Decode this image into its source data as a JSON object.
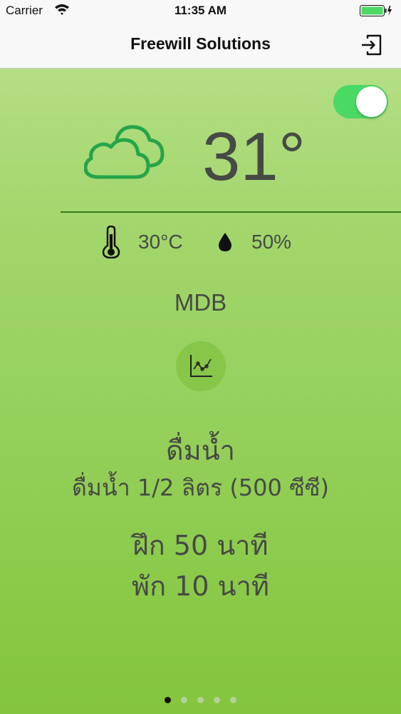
{
  "status_bar": {
    "carrier": "Carrier",
    "time": "11:35 AM"
  },
  "nav": {
    "title": "Freewill Solutions",
    "logout_icon": "logout-icon"
  },
  "toggle": {
    "on": true,
    "color": "#4bd965"
  },
  "weather": {
    "icon": "cloud-icon",
    "temperature": "31°",
    "temp_c": "30°C",
    "humidity": "50%"
  },
  "location": "MDB",
  "chart_button_icon": "chart-icon",
  "advice": {
    "title": "ดื่มน้ำ",
    "detail": "ดื่มน้ำ 1/2 ลิตร (500 ซีซี)",
    "training": "ฝึก 50 นาที",
    "rest": "พัก 10 นาที"
  },
  "pagination": {
    "total": 5,
    "current": 1
  },
  "colors": {
    "accent": "#87c548",
    "icon_green": "#25a54a"
  }
}
